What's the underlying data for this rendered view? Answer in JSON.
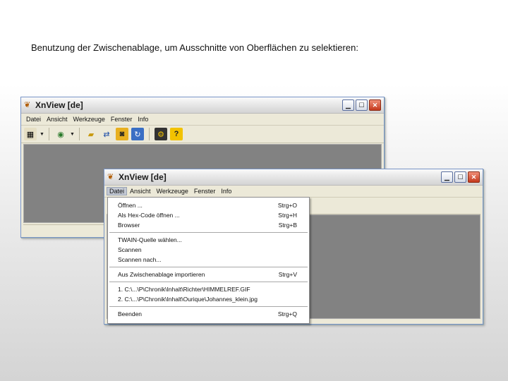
{
  "caption": "Benutzung der Zwischenablage, um Ausschnitte von Oberflächen zu selektieren:",
  "window_back": {
    "title": "XnView [de]",
    "menu": [
      "Datei",
      "Ansicht",
      "Werkzeuge",
      "Fenster",
      "Info"
    ]
  },
  "window_front": {
    "title": "XnView [de]",
    "menu": [
      "Datei",
      "Ansicht",
      "Werkzeuge",
      "Fenster",
      "Info"
    ],
    "active_menu": "Datei"
  },
  "window_buttons": [
    "minimize-icon",
    "maximize-icon",
    "close-icon"
  ],
  "toolbar_icons": [
    "browser-icon",
    "scanner-icon",
    "open-folder-icon",
    "convert-icon",
    "capture-icon",
    "refresh-icon",
    "settings-icon",
    "help-icon"
  ],
  "file_menu": {
    "group1": [
      {
        "label": "Öffnen ...",
        "shortcut": "Strg+O"
      },
      {
        "label": "Als Hex-Code öffnen ...",
        "shortcut": "Strg+H"
      },
      {
        "label": "Browser",
        "shortcut": "Strg+B"
      }
    ],
    "group2": [
      {
        "label": "TWAIN-Quelle wählen...",
        "shortcut": ""
      },
      {
        "label": "Scannen",
        "shortcut": ""
      },
      {
        "label": "Scannen nach...",
        "shortcut": ""
      }
    ],
    "group3": [
      {
        "label": "Aus Zwischenablage importieren",
        "shortcut": "Strg+V"
      }
    ],
    "group4": [
      {
        "label": "1. C:\\...\\P\\Chronik\\Inhalt\\Richter\\HIMMELREF.GIF",
        "shortcut": ""
      },
      {
        "label": "2. C:\\...\\P\\Chronik\\Inhalt\\Ourique\\Johannes_klein.jpg",
        "shortcut": ""
      }
    ],
    "group5": [
      {
        "label": "Beenden",
        "shortcut": "Strg+Q"
      }
    ]
  },
  "colors": {
    "workspace": "#828282",
    "window_face": "#ece9d8",
    "close_button": "#c4391c"
  }
}
